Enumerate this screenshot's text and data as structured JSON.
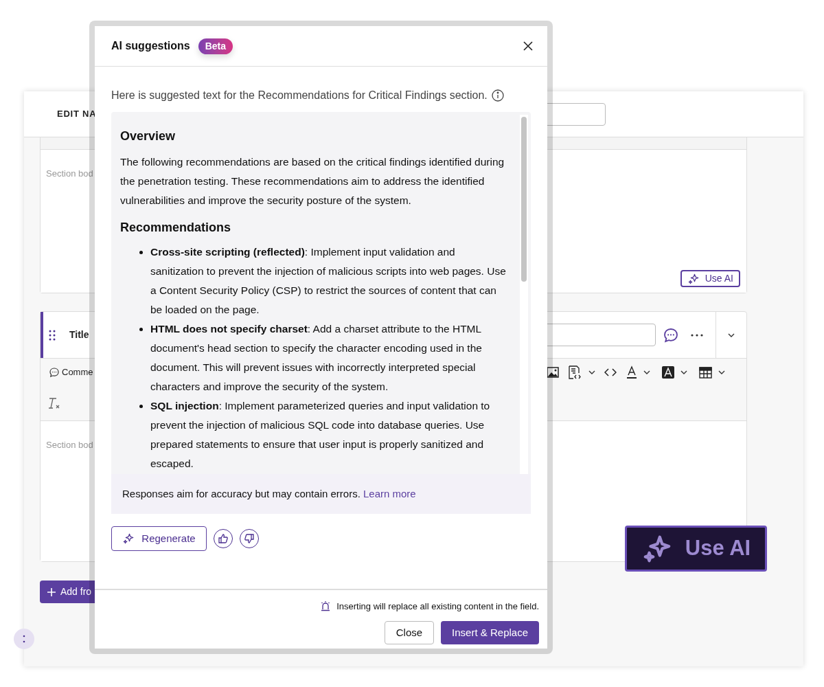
{
  "editor": {
    "heading": "EDIT NA",
    "section_1": {
      "placeholder": "Section bod",
      "ai_button": "Use AI"
    },
    "section_2": {
      "title_label": "Title",
      "comment_label": "Comme",
      "placeholder": "Section bod"
    },
    "add_button": "Add fro"
  },
  "dialog": {
    "title": "AI suggestions",
    "badge": "Beta",
    "intro": "Here is suggested text for the Recommendations for Critical Findings section.",
    "content": {
      "overview_heading": "Overview",
      "overview_text": "The following recommendations are based on the critical findings identified during the penetration testing. These recommendations aim to address the identified vulnerabilities and improve the security posture of the system.",
      "recommendations_heading": "Recommendations",
      "items": [
        "**Cross-site scripting (reflected)**: Implement input validation and sanitization to prevent the injection of malicious scripts into web pages. Use a Content Security Policy (CSP) to restrict the sources of content that can be loaded on the page.",
        "**HTML does not specify charset**: Add a charset attribute to the HTML document's head section to specify the character encoding used in the document. This will prevent issues with incorrectly interpreted special characters and improve the security of the system.",
        "**SQL injection**: Implement parameterized queries and input validation to prevent the injection of malicious SQL code into database queries. Use prepared statements to ensure that user input is properly sanitized and escaped."
      ]
    },
    "disclaimer": "Responses aim for accuracy but may contain errors.",
    "learn_more": "Learn more",
    "regenerate": "Regenerate",
    "warning": "Inserting will replace all existing content in the field.",
    "buttons": [
      {
        "label": "Close",
        "kind": "secondary"
      },
      {
        "label": "Insert & Replace",
        "kind": "primary"
      }
    ]
  },
  "callout": {
    "label": "Use AI"
  }
}
